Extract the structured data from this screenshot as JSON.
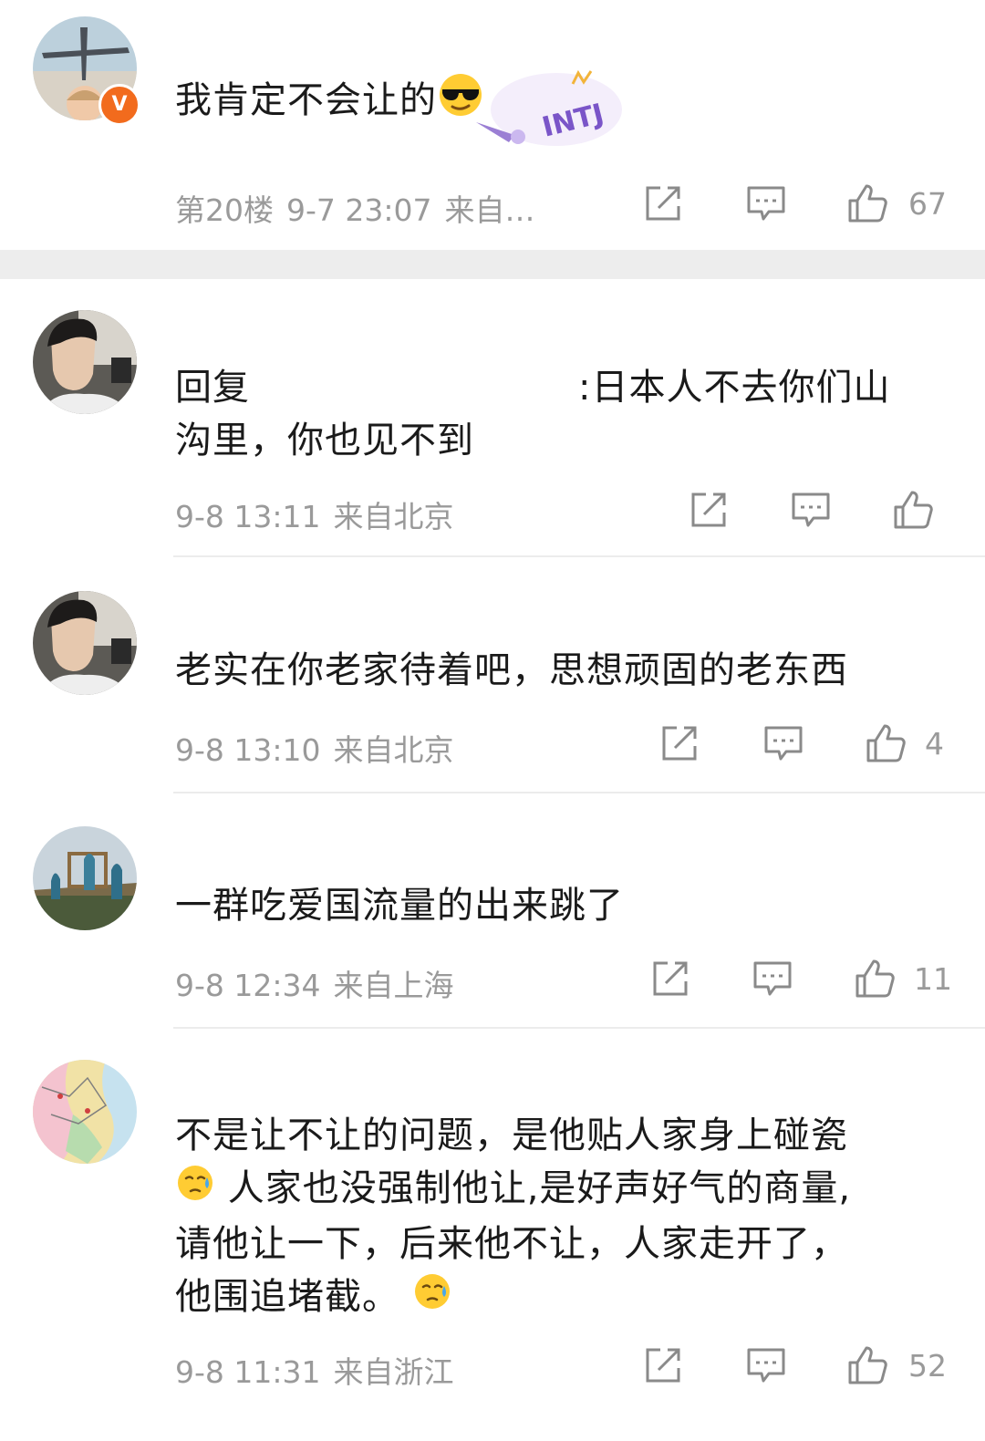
{
  "comments": [
    {
      "text": "我肯定不会让的",
      "floor": "第20楼",
      "time": "9-7 23:07",
      "source": "来自…",
      "likes": "67",
      "badge": "V",
      "decoration": "INTJ"
    },
    {
      "text_part1": "回复",
      "text_part2": ":日本人不去你们山",
      "text_line2": "沟里，你也见不到",
      "time": "9-8 13:11",
      "source": "来自北京",
      "likes": ""
    },
    {
      "text": "老实在你老家待着吧，思想顽固的老东西",
      "time": "9-8 13:10",
      "source": "来自北京",
      "likes": "4"
    },
    {
      "text": "一群吃爱国流量的出来跳了",
      "time": "9-8 12:34",
      "source": "来自上海",
      "likes": "11"
    },
    {
      "line1": "不是让不让的问题，是他贴人家身上碰瓷",
      "line2": "人家也没强制他让,是好声好气的商量,",
      "line3": "请他让一下，后来他不让，人家走开了，",
      "line4": "他围追堵截。",
      "time": "9-8 11:31",
      "source": "来自浙江",
      "likes": "52"
    }
  ],
  "icons": {
    "share": "share-icon",
    "comment": "comment-icon",
    "like": "like-icon",
    "cool_emoji": "sunglasses-emoji-icon",
    "sweat_emoji": "sweat-emoji-icon"
  },
  "colors": {
    "meta_text": "#9a9a9a",
    "badge": "#f26b1d",
    "separator": "#ededed"
  }
}
